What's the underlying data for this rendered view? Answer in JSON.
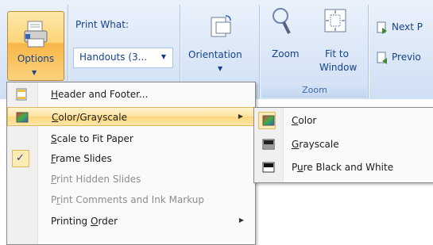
{
  "ribbon": {
    "options_label": "Options",
    "print_what_label": "Print What:",
    "print_what_value": "Handouts (3...",
    "orientation_label": "Orientation",
    "zoom_label": "Zoom",
    "fit_to_window_line1": "Fit to",
    "fit_to_window_line2": "Window",
    "zoom_group_label": "Zoom",
    "next_page_label": "Next P",
    "previous_page_label": "Previo"
  },
  "menu": {
    "items": [
      {
        "prefix": "",
        "key": "H",
        "rest": "eader and Footer...",
        "enabled": true,
        "submenu": false
      },
      {
        "prefix": "",
        "key": "C",
        "rest": "olor/Grayscale",
        "enabled": true,
        "submenu": true,
        "highlighted": true
      },
      {
        "prefix": "",
        "key": "S",
        "rest": "cale to Fit Paper",
        "enabled": true,
        "submenu": false
      },
      {
        "prefix": "",
        "key": "F",
        "rest": "rame Slides",
        "enabled": true,
        "submenu": false,
        "checked": true
      },
      {
        "prefix": "",
        "key": "P",
        "rest": "rint Hidden Slides",
        "enabled": false,
        "submenu": false
      },
      {
        "prefix": "P",
        "key": "r",
        "rest": "int Comments and Ink Markup",
        "enabled": false,
        "submenu": false
      },
      {
        "prefix": "Printing ",
        "key": "O",
        "rest": "rder",
        "enabled": true,
        "submenu": true
      }
    ]
  },
  "submenu": {
    "items": [
      {
        "prefix": "",
        "key": "C",
        "rest": "olor",
        "selected": true
      },
      {
        "prefix": "",
        "key": "G",
        "rest": "rayscale",
        "selected": false
      },
      {
        "prefix": "P",
        "key": "u",
        "rest": "re Black and White",
        "selected": false
      }
    ]
  },
  "colors": {
    "ribbon_bg": "#dbe7f7",
    "highlight": "#fde3a0",
    "menu_text": "#1b1b1b",
    "disabled_text": "#8d8d8d"
  }
}
